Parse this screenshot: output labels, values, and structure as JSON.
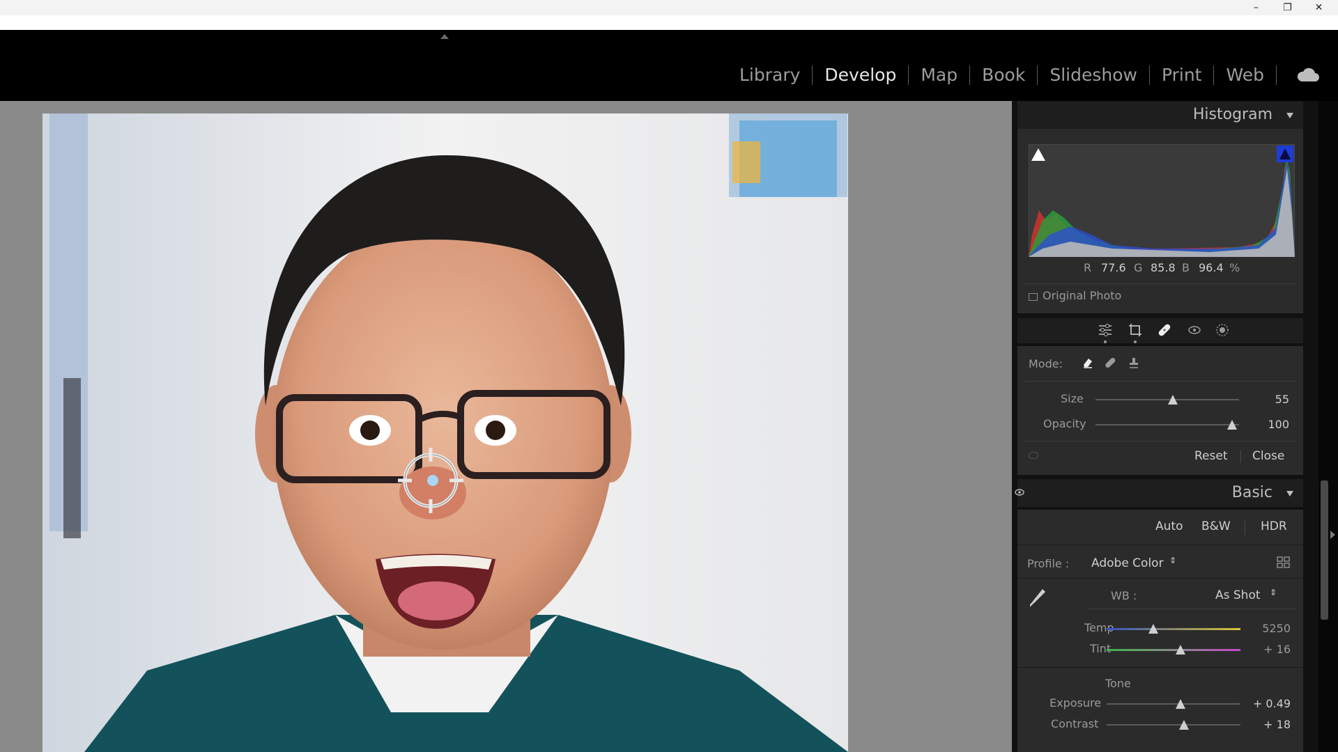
{
  "window": {
    "minimize": "–",
    "restore": "❐",
    "close": "✕"
  },
  "modules": [
    {
      "label": "Library",
      "active": false
    },
    {
      "label": "Develop",
      "active": true
    },
    {
      "label": "Map",
      "active": false
    },
    {
      "label": "Book",
      "active": false
    },
    {
      "label": "Slideshow",
      "active": false
    },
    {
      "label": "Print",
      "active": false
    },
    {
      "label": "Web",
      "active": false
    }
  ],
  "histogram": {
    "title": "Histogram",
    "readout": {
      "r_label": "R",
      "r": "77.6",
      "g_label": "G",
      "g": "85.8",
      "b_label": "B",
      "b": "96.4",
      "unit": "%"
    },
    "original_photo": "Original Photo"
  },
  "tools": [
    "sliders-icon",
    "crop-icon",
    "healing-icon",
    "redeye-icon",
    "mask-icon"
  ],
  "healing": {
    "mode_label": "Mode:",
    "size_label": "Size",
    "size_value": "55",
    "size_fraction": 0.54,
    "opacity_label": "Opacity",
    "opacity_value": "100",
    "opacity_fraction": 0.95,
    "reset": "Reset",
    "close": "Close"
  },
  "basic": {
    "title": "Basic",
    "auto": "Auto",
    "bw": "B&W",
    "hdr": "HDR",
    "profile_label": "Profile :",
    "profile_value": "Adobe Color",
    "wb_label": "WB :",
    "wb_value": "As Shot",
    "temp_label": "Temp",
    "temp_value": "5250",
    "temp_fraction": 0.35,
    "tint_label": "Tint",
    "tint_value": "+ 16",
    "tint_fraction": 0.55,
    "tone_label": "Tone",
    "exposure_label": "Exposure",
    "exposure_value": "+ 0.49",
    "exposure_fraction": 0.55,
    "contrast_label": "Contrast",
    "contrast_value": "+ 18",
    "contrast_fraction": 0.58
  },
  "colors": {
    "accent_blue": "#1e3cd8",
    "panel": "#2b2b2b",
    "header": "#1e1e1e",
    "photo_bg": "#8a8a8a"
  }
}
